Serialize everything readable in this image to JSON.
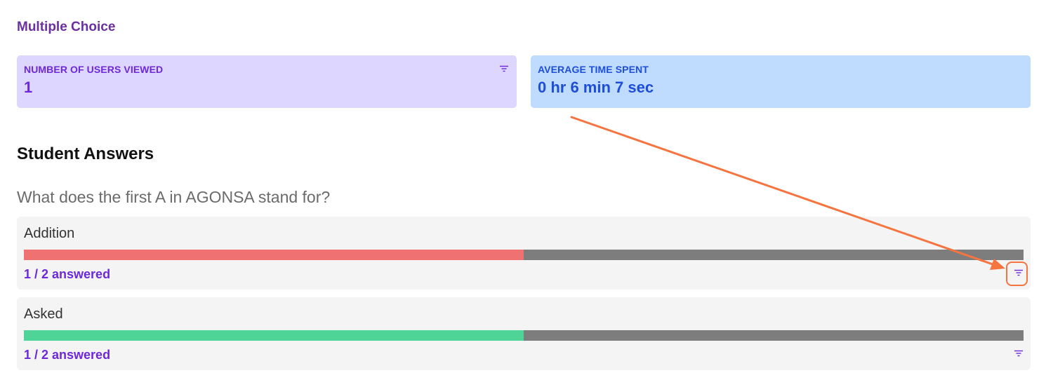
{
  "section": {
    "title": "Multiple Choice"
  },
  "stats": {
    "users_viewed": {
      "label": "NUMBER OF USERS VIEWED",
      "value": "1"
    },
    "avg_time": {
      "label": "AVERAGE TIME SPENT",
      "value": "0 hr 6 min 7 sec"
    }
  },
  "answers": {
    "heading": "Student Answers",
    "question": "What does the first A in AGONSA stand for?",
    "options": [
      {
        "label": "Addition",
        "answered": "1 / 2 answered",
        "fraction": 0.5,
        "color": "#f07171"
      },
      {
        "label": "Asked",
        "answered": "1 / 2 answered",
        "fraction": 0.5,
        "color": "#4fd497"
      }
    ]
  },
  "colors": {
    "title": "#6b2fa0",
    "users_card_bg": "#ddd6fe",
    "time_card_bg": "#bfdbfe",
    "bar_remaining": "#7d7d7d",
    "annotation": "#f5743f"
  },
  "icons": {
    "filter": "filter-icon"
  }
}
